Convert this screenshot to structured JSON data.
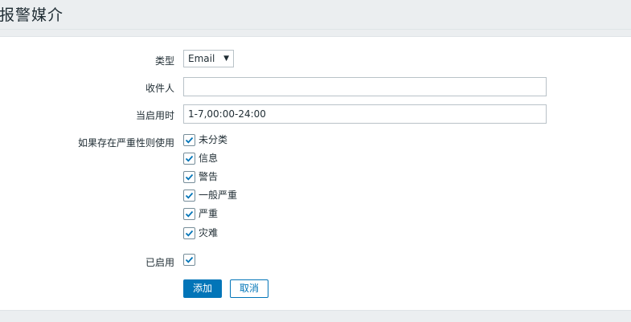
{
  "page": {
    "title": "报警媒介"
  },
  "form": {
    "type": {
      "label": "类型",
      "value": "Email"
    },
    "recipient": {
      "label": "收件人",
      "value": ""
    },
    "when_active": {
      "label": "当启用时",
      "value": "1-7,00:00-24:00"
    },
    "severity": {
      "label": "如果存在严重性则使用",
      "items": [
        {
          "label": "未分类",
          "checked": true
        },
        {
          "label": "信息",
          "checked": true
        },
        {
          "label": "警告",
          "checked": true
        },
        {
          "label": "一般严重",
          "checked": true
        },
        {
          "label": "严重",
          "checked": true
        },
        {
          "label": "灾难",
          "checked": true
        }
      ]
    },
    "enabled": {
      "label": "已启用",
      "checked": true
    },
    "buttons": {
      "add": "添加",
      "cancel": "取消"
    }
  },
  "colors": {
    "accent": "#0275b8",
    "background": "#ebeef0",
    "panel": "#ffffff"
  }
}
